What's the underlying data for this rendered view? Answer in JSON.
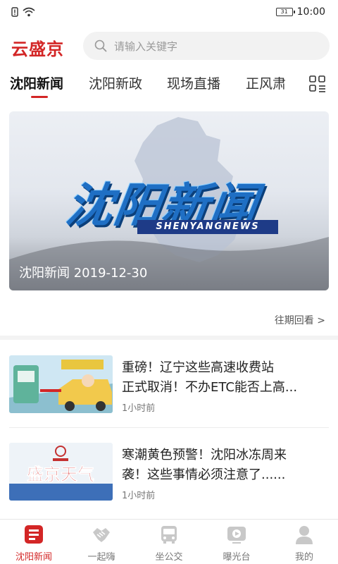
{
  "status_bar": {
    "time": "10:00",
    "battery": "31"
  },
  "header": {
    "logo": "云盛京",
    "search_placeholder": "请输入关键字"
  },
  "tabs": [
    {
      "label": "沈阳新闻",
      "active": true
    },
    {
      "label": "沈阳新政"
    },
    {
      "label": "现场直播"
    },
    {
      "label": "正风肃"
    }
  ],
  "hero": {
    "title_art": "沈阳新闻",
    "subtitle_art": "SHENYANGNEWS",
    "caption": "沈阳新闻 2019-12-30"
  },
  "more_link": "往期回看 >",
  "news": [
    {
      "title_line1": "重磅！辽宁这些高速收费站",
      "title_line2": "正式取消！不办ETC能否上高...",
      "time": "1小时前",
      "thumb_text": "收费站"
    },
    {
      "title_line1": "寒潮黄色预警！沈阳冰冻周来",
      "title_line2": "袭！这些事情必须注意了......",
      "time": "1小时前",
      "thumb_text": "盛京天气"
    }
  ],
  "bottom_nav": [
    {
      "label": "沈阳新闻",
      "icon": "news-icon",
      "active": true
    },
    {
      "label": "一起嗨",
      "icon": "handshake-icon"
    },
    {
      "label": "坐公交",
      "icon": "bus-icon"
    },
    {
      "label": "曝光台",
      "icon": "video-icon"
    },
    {
      "label": "我的",
      "icon": "person-icon"
    }
  ],
  "colors": {
    "accent": "#d32626",
    "hero_blue": "#1f6fc4"
  }
}
